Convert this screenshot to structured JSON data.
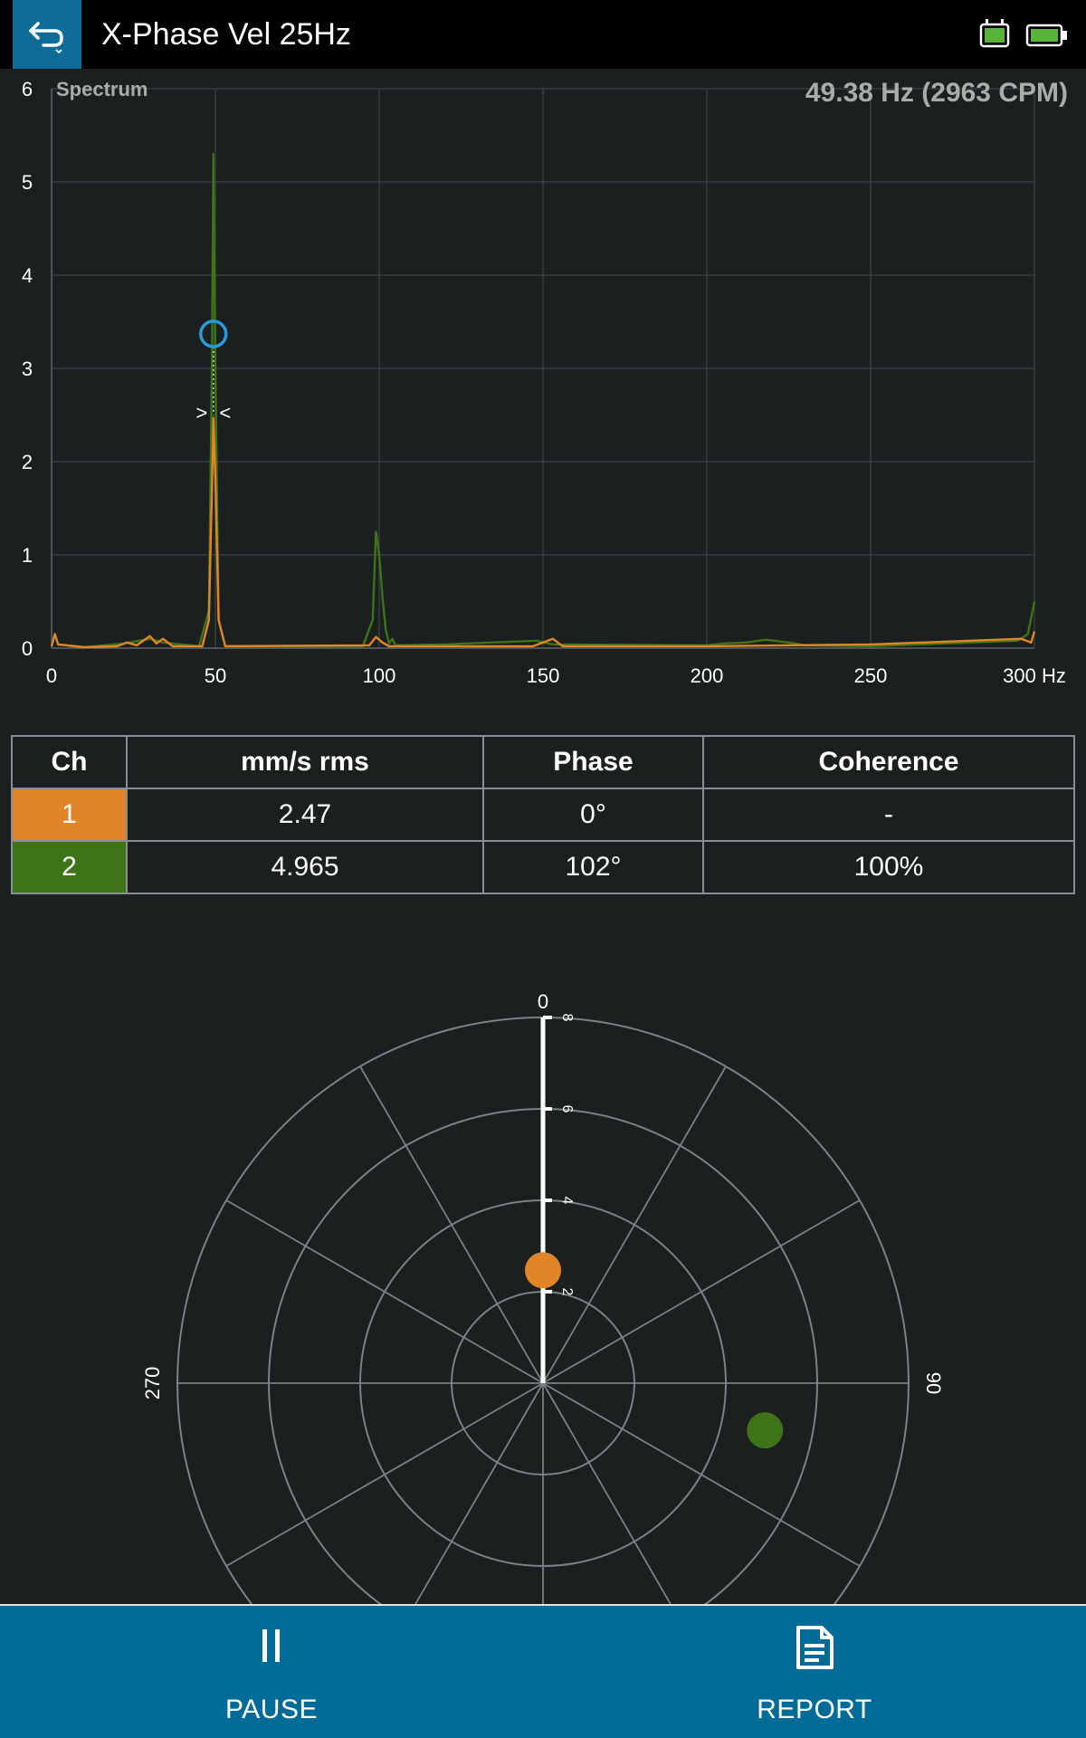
{
  "header": {
    "title": "X-Phase Vel 25Hz",
    "back_icon": "back-arrow-icon",
    "sim_icon": "sim-card-icon",
    "battery_icon": "battery-icon"
  },
  "spectrum": {
    "title": "Spectrum",
    "cursor_readout": "49.38 Hz (2963 CPM)"
  },
  "table": {
    "headers": {
      "ch": "Ch",
      "value": "mm/s rms",
      "phase": "Phase",
      "coherence": "Coherence"
    },
    "rows": [
      {
        "ch": "1",
        "value": "2.47",
        "phase": "0°",
        "coherence": "-",
        "color": "#e08628"
      },
      {
        "ch": "2",
        "value": "4.965",
        "phase": "102°",
        "coherence": "100%",
        "color": "#3e7417"
      }
    ]
  },
  "polar": {
    "angle_labels": {
      "top": "0",
      "right": "90",
      "left": "270"
    },
    "radial_ticks": [
      "2",
      "4",
      "6",
      "8"
    ]
  },
  "bottom": {
    "pause_label": "PAUSE",
    "report_label": "REPORT",
    "pause_icon": "pause-icon",
    "report_icon": "document-icon"
  },
  "colors": {
    "ch1": "#e08628",
    "ch2": "#3e7417",
    "accent": "#0e6c97",
    "cursor": "#2a9bd8"
  },
  "chart_data": [
    {
      "type": "line",
      "title": "Spectrum",
      "xlabel": "Hz",
      "ylabel": "",
      "xlim": [
        0,
        300
      ],
      "ylim": [
        0,
        6
      ],
      "x_ticks": [
        "0",
        "50",
        "100",
        "150",
        "200",
        "250",
        "300 Hz"
      ],
      "y_ticks": [
        "0",
        "1",
        "2",
        "3",
        "4",
        "5",
        "6"
      ],
      "grid": true,
      "cursor": {
        "x": 49.38,
        "y": 3.37
      },
      "series": [
        {
          "channel": "2",
          "color": "#3e7417",
          "points": [
            [
              0,
              0.02
            ],
            [
              1,
              0.15
            ],
            [
              2,
              0.04
            ],
            [
              10,
              0.01
            ],
            [
              22,
              0.05
            ],
            [
              30,
              0.1
            ],
            [
              34,
              0.06
            ],
            [
              45,
              0.02
            ],
            [
              48,
              0.4
            ],
            [
              49,
              3.2
            ],
            [
              49.38,
              5.3
            ],
            [
              50,
              3.0
            ],
            [
              51,
              0.3
            ],
            [
              53,
              0.02
            ],
            [
              95,
              0.02
            ],
            [
              98,
              0.3
            ],
            [
              99,
              1.25
            ],
            [
              100,
              1.0
            ],
            [
              101,
              0.55
            ],
            [
              102,
              0.2
            ],
            [
              103,
              0.05
            ],
            [
              104,
              0.1
            ],
            [
              105,
              0.03
            ],
            [
              120,
              0.04
            ],
            [
              148,
              0.08
            ],
            [
              153,
              0.04
            ],
            [
              200,
              0.03
            ],
            [
              205,
              0.05
            ],
            [
              212,
              0.06
            ],
            [
              218,
              0.09
            ],
            [
              225,
              0.06
            ],
            [
              230,
              0.03
            ],
            [
              250,
              0.02
            ],
            [
              295,
              0.08
            ],
            [
              298,
              0.15
            ],
            [
              300,
              0.5
            ]
          ]
        },
        {
          "channel": "1",
          "color": "#e08628",
          "points": [
            [
              0,
              0.02
            ],
            [
              1,
              0.15
            ],
            [
              2,
              0.04
            ],
            [
              10,
              0.01
            ],
            [
              20,
              0.02
            ],
            [
              23,
              0.06
            ],
            [
              26,
              0.03
            ],
            [
              30,
              0.13
            ],
            [
              32,
              0.05
            ],
            [
              34,
              0.1
            ],
            [
              37,
              0.02
            ],
            [
              46,
              0.02
            ],
            [
              48,
              0.3
            ],
            [
              49,
              1.8
            ],
            [
              49.38,
              2.47
            ],
            [
              50,
              1.8
            ],
            [
              51,
              0.3
            ],
            [
              53,
              0.02
            ],
            [
              97,
              0.03
            ],
            [
              99,
              0.12
            ],
            [
              101,
              0.06
            ],
            [
              103,
              0.02
            ],
            [
              147,
              0.02
            ],
            [
              150,
              0.06
            ],
            [
              153,
              0.1
            ],
            [
              156,
              0.02
            ],
            [
              200,
              0.02
            ],
            [
              250,
              0.04
            ],
            [
              296,
              0.1
            ],
            [
              299,
              0.06
            ],
            [
              300,
              0.18
            ]
          ]
        }
      ]
    },
    {
      "type": "scatter",
      "subtype": "polar",
      "radial_range": [
        0,
        8
      ],
      "angle_zero": "top",
      "angle_direction": "clockwise",
      "points": [
        {
          "channel": "1",
          "magnitude": 2.47,
          "phase_deg": 0,
          "color": "#e08628"
        },
        {
          "channel": "2",
          "magnitude": 4.965,
          "phase_deg": 102,
          "color": "#3e7417"
        }
      ]
    }
  ]
}
